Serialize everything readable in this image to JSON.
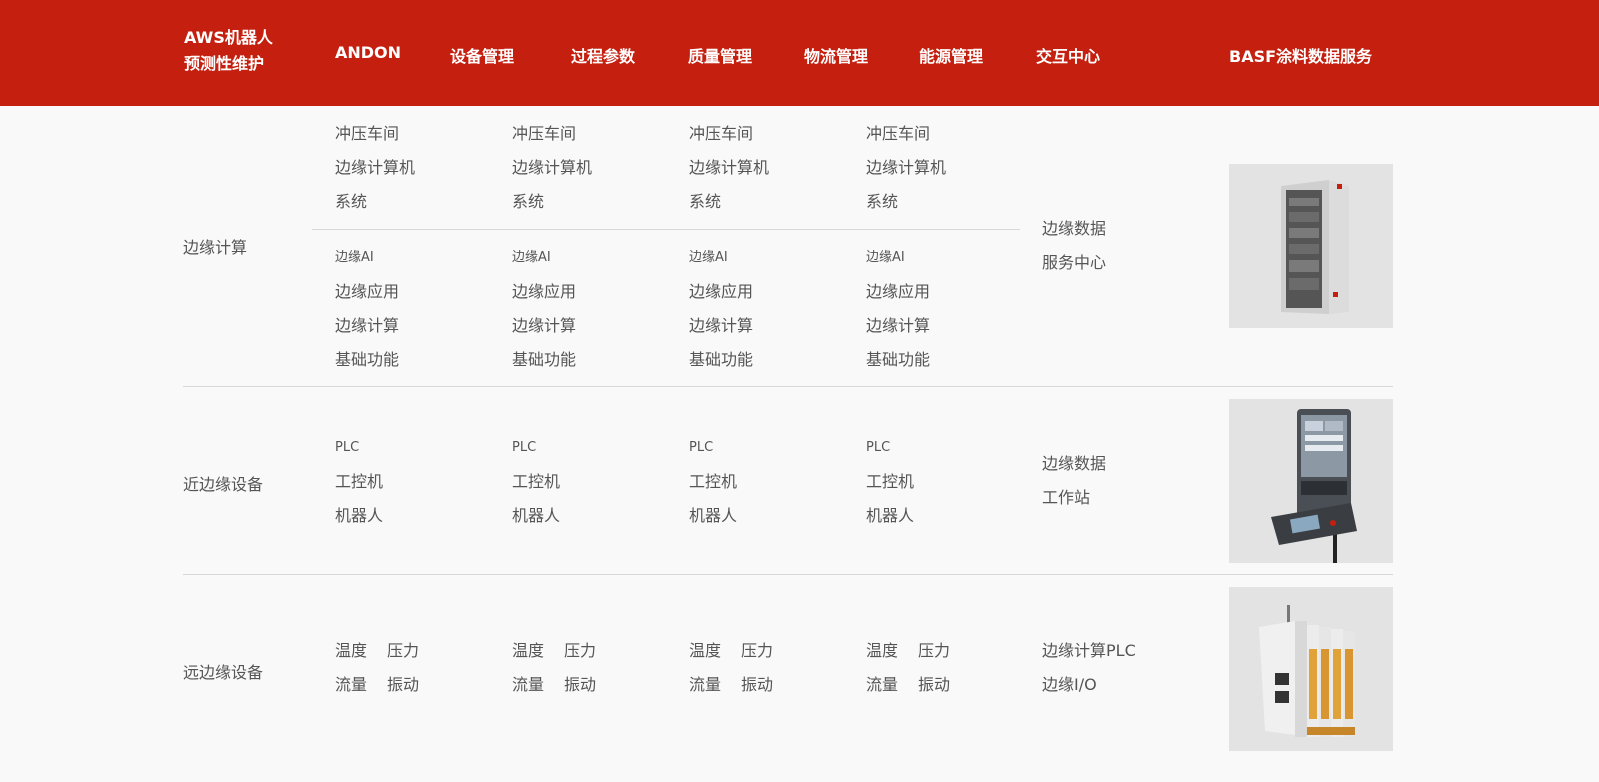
{
  "nav": {
    "aws_line1": "AWS机器人",
    "aws_line2": "预测性维护",
    "andon": "ANDON",
    "equipment": "设备管理",
    "process": "过程参数",
    "quality": "质量管理",
    "logistics": "物流管理",
    "energy": "能源管理",
    "interaction": "交互中心",
    "basf": "BASF涂料数据服务"
  },
  "edge": {
    "label": "边缘计算",
    "group1": [
      "冲压车间",
      "边缘计算机",
      "系统"
    ],
    "group2": [
      "边缘AI",
      "边缘应用",
      "边缘计算",
      "基础功能"
    ],
    "side": [
      "边缘数据",
      "服务中心"
    ],
    "image_icon": "edge-server-cabinet"
  },
  "near": {
    "label": "近边缘设备",
    "items": [
      "PLC",
      "工控机",
      "机器人"
    ],
    "side": [
      "边缘数据",
      "工作站"
    ],
    "image_icon": "hmi-panel-workstation"
  },
  "far": {
    "label": "远边缘设备",
    "pair1": [
      "温度",
      "压力"
    ],
    "pair2": [
      "流量",
      "振动"
    ],
    "side": [
      "边缘计算PLC",
      "边缘I/O"
    ],
    "image_icon": "edge-plc-io-module"
  }
}
